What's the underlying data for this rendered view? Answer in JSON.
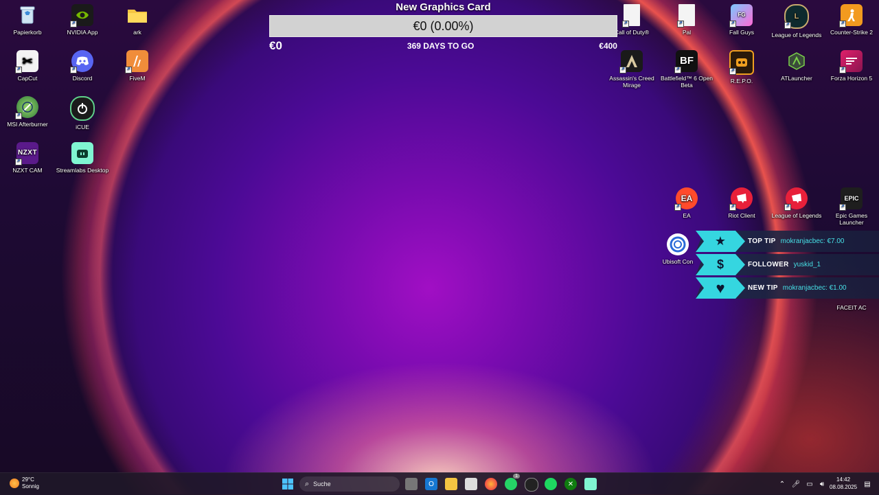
{
  "desktop": {
    "icons": [
      {
        "label": "Papierkorb"
      },
      {
        "label": "NVIDIA App"
      },
      {
        "label": "ark"
      },
      {
        "label": "CapCut"
      },
      {
        "label": "Discord"
      },
      {
        "label": "FiveM"
      },
      {
        "label": "MSI Afterburner"
      },
      {
        "label": "iCUE"
      },
      {
        "label": "NZXT CAM"
      },
      {
        "label": "Streamlabs Desktop"
      },
      {
        "label": "Call of Duty®"
      },
      {
        "label": "Pal"
      },
      {
        "label": "Fall Guys"
      },
      {
        "label": "League of Legends"
      },
      {
        "label": "Counter-Strike 2"
      },
      {
        "label": "Assassin's Creed Mirage"
      },
      {
        "label": "Battlefield™ 6 Open Beta"
      },
      {
        "label": "R.E.P.O."
      },
      {
        "label": "ATLauncher"
      },
      {
        "label": "Forza Horizon 5"
      },
      {
        "label": "EA"
      },
      {
        "label": "Riot Client"
      },
      {
        "label": "League of Legends"
      },
      {
        "label": "Epic Games Launcher"
      },
      {
        "label": "Ubisoft Con"
      },
      {
        "label": "FACEIT AC"
      }
    ]
  },
  "goal": {
    "title": "New Graphics Card",
    "bar_text": "€0 (0.00%)",
    "progress_fraction": 0.0,
    "min_label": "€0",
    "days_label": "369 DAYS TO GO",
    "max_label": "€400"
  },
  "alerts": [
    {
      "label": "TOP TIP",
      "value": "mokranjacbec: €7.00",
      "icon": "star-icon",
      "glyph": "★"
    },
    {
      "label": "FOLLOWER",
      "value": "yuskid_1",
      "icon": "dollar-icon",
      "glyph": "$"
    },
    {
      "label": "NEW TIP",
      "value": "mokranjacbec: €1.00",
      "icon": "heart-icon",
      "glyph": "♥"
    }
  ],
  "taskbar": {
    "weather_temp": "29°C",
    "weather_desc": "Sonnig",
    "search_placeholder": "Suche",
    "time": "14:42",
    "date": "08.08.2025",
    "whatsapp_badge": "1"
  },
  "colors": {
    "accent_cyan": "#35d6e0",
    "goal_bar_bg": "#d2d2d2"
  }
}
